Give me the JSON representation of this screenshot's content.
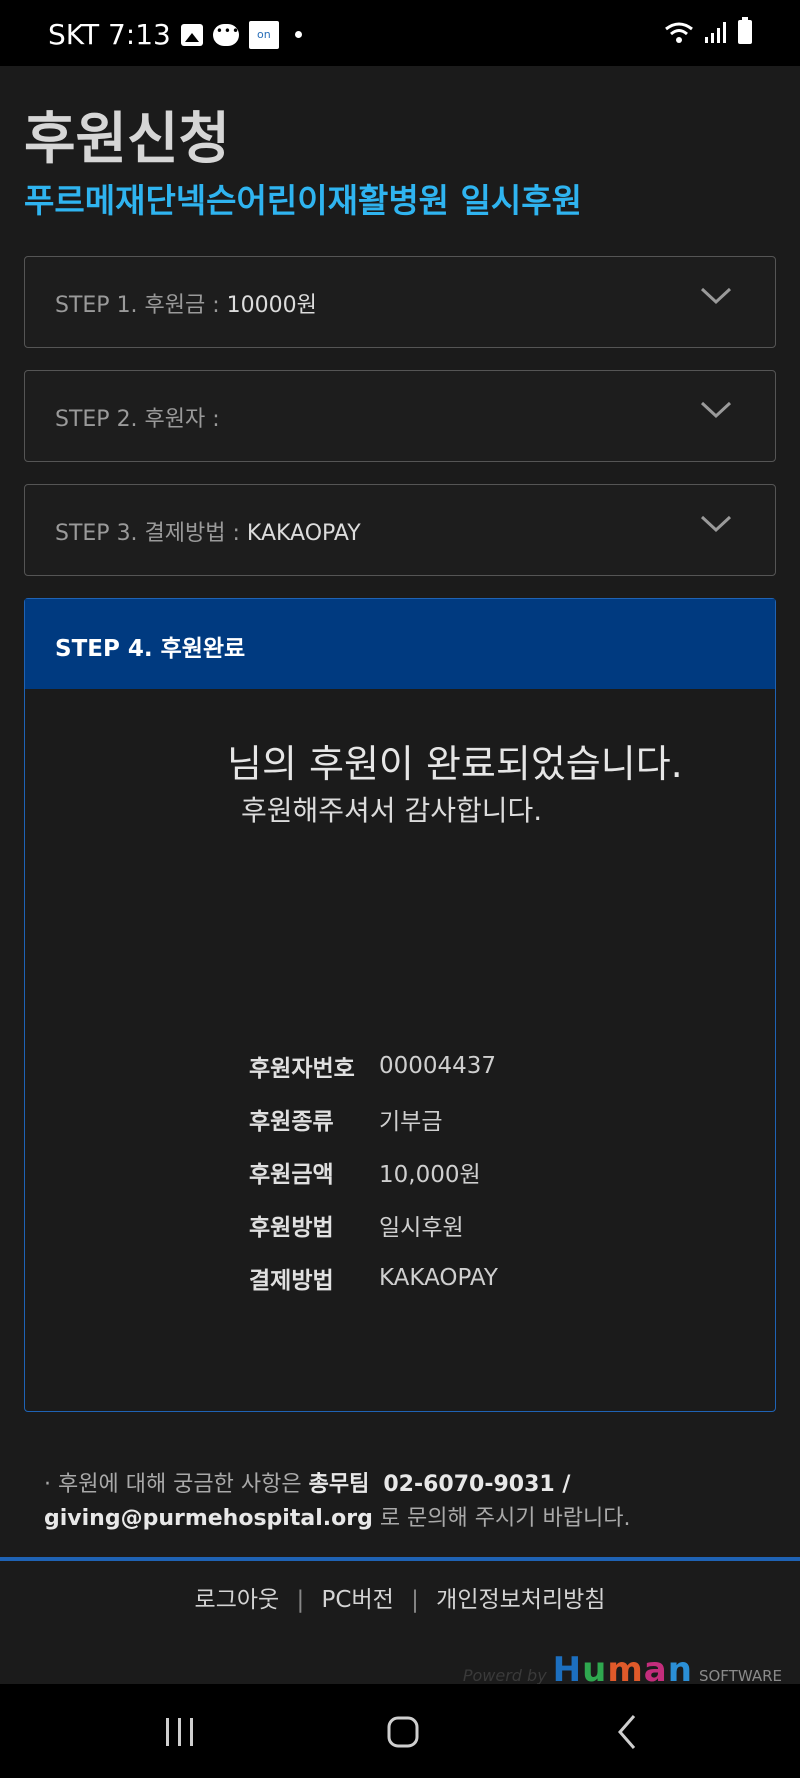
{
  "status_bar": {
    "carrier_time": "SKT 7:13",
    "icons": [
      "image-icon",
      "chat-icon",
      "on-badge-icon",
      "dot-icon",
      "wifi-icon",
      "signal-icon",
      "battery-icon"
    ],
    "badge_text": "on"
  },
  "page": {
    "title": "후원신청",
    "subtitle": "푸르메재단넥슨어린이재활병원 일시후원"
  },
  "steps": [
    {
      "prefix": "STEP 1. 후원금 : ",
      "value": "10000원"
    },
    {
      "prefix": "STEP 2. 후원자 : ",
      "value": ""
    },
    {
      "prefix": "STEP 3. 결제방법 : ",
      "value": "KAKAOPAY"
    }
  ],
  "step4": {
    "title": "STEP 4. 후원완료",
    "done_message": "님의 후원이 완료되었습니다.",
    "thanks_message": "후원해주셔서 감사합니다.",
    "details": [
      {
        "key": "후원자번호",
        "value": "00004437"
      },
      {
        "key": "후원종류",
        "value": "기부금"
      },
      {
        "key": "후원금액",
        "value": "10,000원"
      },
      {
        "key": "후원방법",
        "value": "일시후원"
      },
      {
        "key": "결제방법",
        "value": "KAKAOPAY"
      }
    ]
  },
  "contact": {
    "lead": "· 후원에 대해 궁금한 사항은 ",
    "team": "총무팀",
    "phone": "02-6070-9031 / giving@purmehospital.org",
    "tail": " 로 문의해 주시기 바랍니다."
  },
  "footer": {
    "links": [
      "로그아웃",
      "PC버전",
      "개인정보처리방침"
    ],
    "separator": "|",
    "powered_by": "Powerd by",
    "brand_letters": [
      "H",
      "u",
      "m",
      "a",
      "n"
    ],
    "brand_suffix": "SOFTWARE"
  },
  "colors": {
    "accent_blue": "#2fb4f0",
    "step4_header": "#003a80",
    "divider": "#1f63b5"
  }
}
